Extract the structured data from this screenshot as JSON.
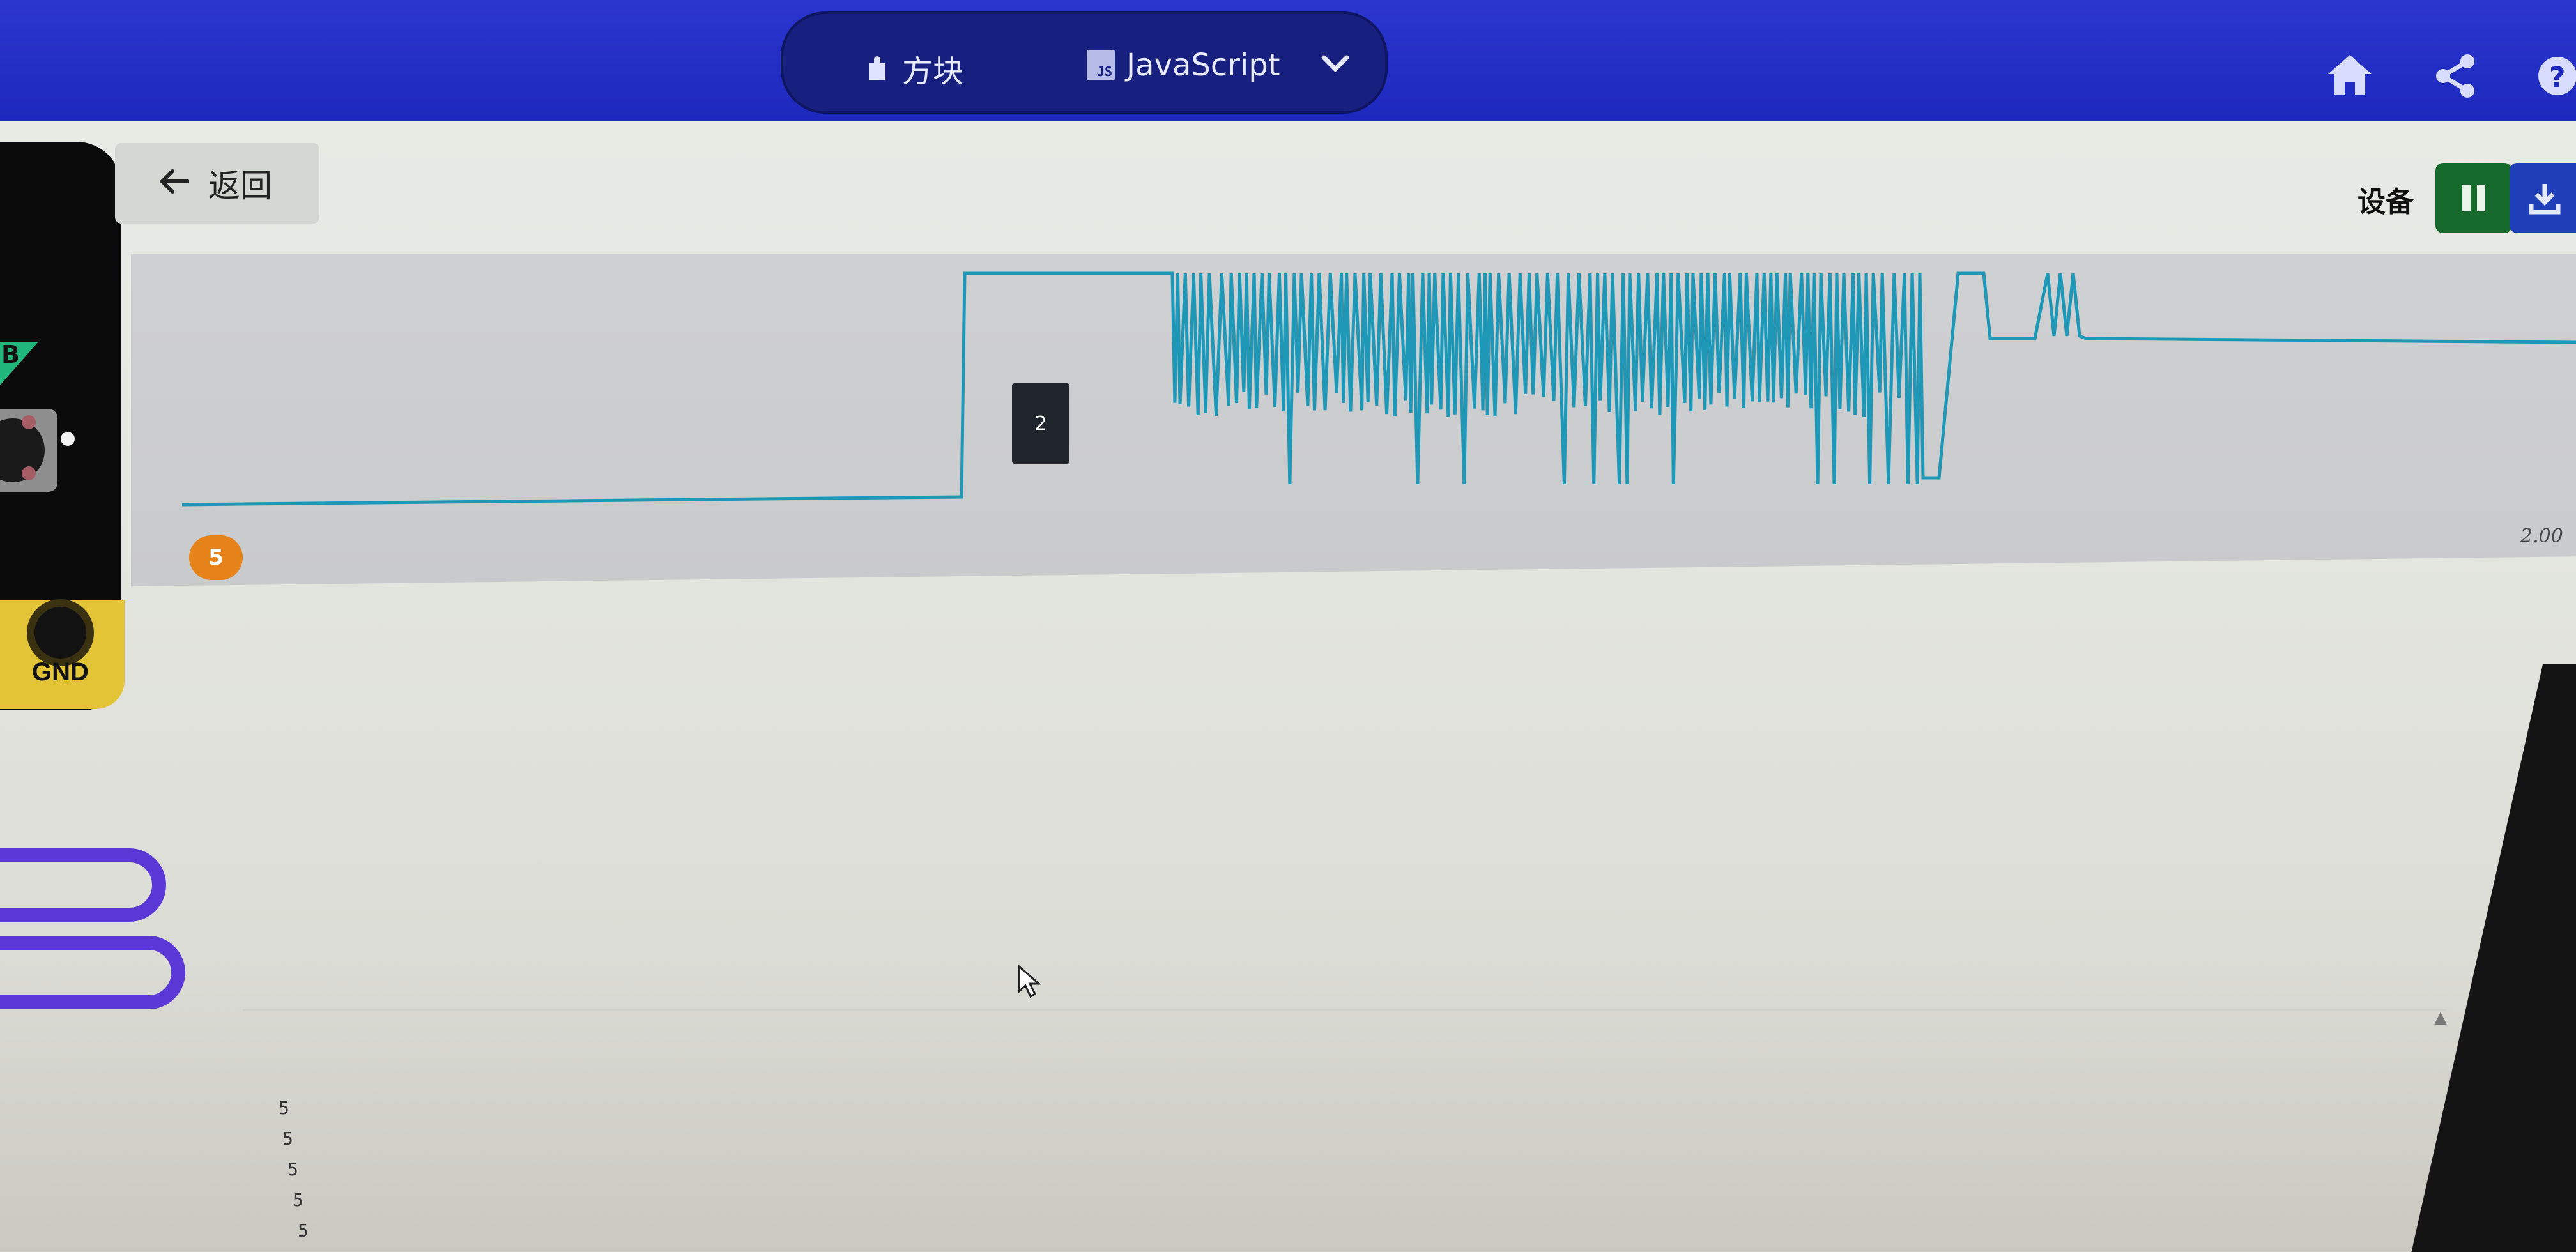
{
  "header": {
    "tabs": [
      {
        "label": "方块",
        "icon": "puzzle-icon"
      },
      {
        "label": "JavaScript",
        "icon": "js-icon"
      }
    ],
    "icons": [
      "home-icon",
      "share-icon",
      "help-icon"
    ]
  },
  "back_button": {
    "label": "返回"
  },
  "device_toolbar": {
    "label": "设备"
  },
  "simulator": {
    "pin_label": "GND",
    "button_label": "B"
  },
  "chart": {
    "badge_value": "5",
    "max_label": "2.00",
    "tooltip_value": "2",
    "line_color": "#1f97b7"
  },
  "console": {
    "lines": [
      "5",
      "5",
      "5",
      "5",
      "5"
    ]
  }
}
